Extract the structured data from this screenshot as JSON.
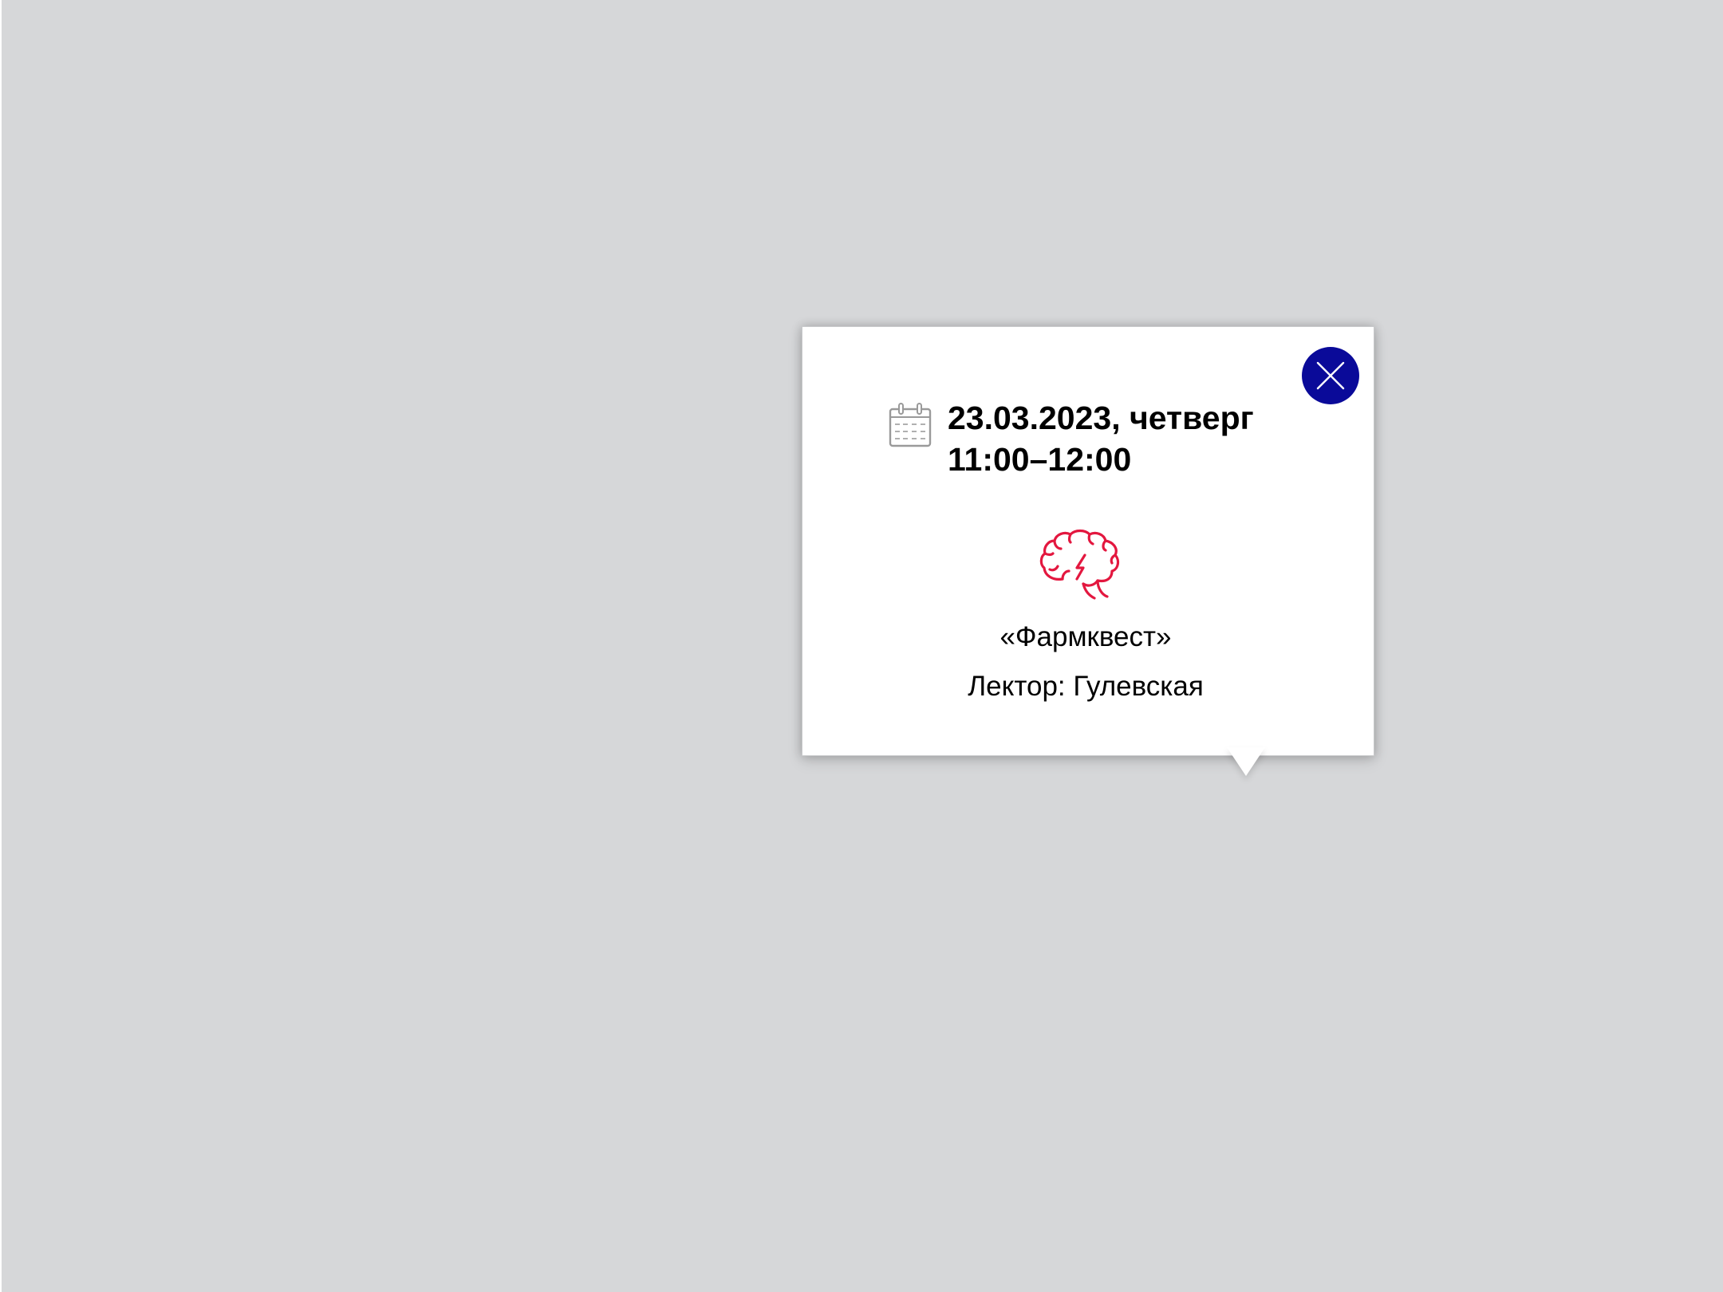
{
  "event_popup": {
    "date_text": "23.03.2023, четверг",
    "time_text": "11:00–12:00",
    "title": "«Фармквест»",
    "lector": "Лектор: Гулевская",
    "icons": {
      "calendar": "calendar-icon",
      "category": "brain-lightning-icon",
      "close": "close-icon"
    },
    "colors": {
      "background": "#d6d7d9",
      "close_button": "#0a0a99",
      "brain_icon": "#e3173f",
      "text": "#000000"
    }
  }
}
